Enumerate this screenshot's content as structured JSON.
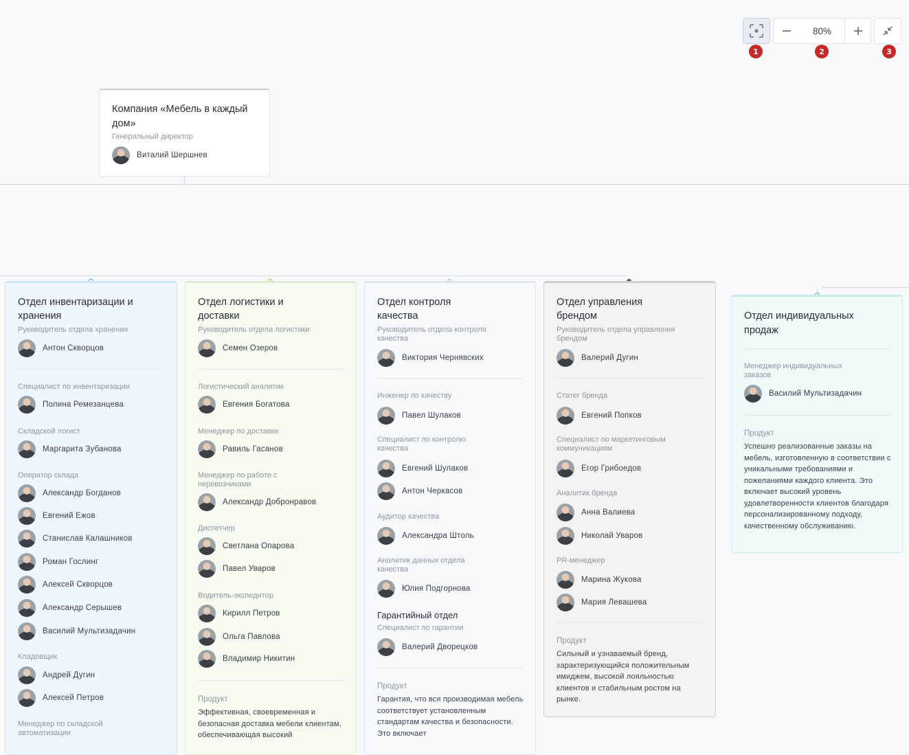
{
  "toolbar": {
    "zoom": "80%",
    "badges": [
      "1",
      "2",
      "3"
    ]
  },
  "colors": {
    "blue": "#3fa3d9",
    "green": "#8dc63f",
    "steel": "#9fb6cc",
    "dark": "#555a5f",
    "teal": "#2ab0a0"
  },
  "root": {
    "title": "Компания «Мебель в каждый дом»",
    "role": "Генеральный директор",
    "person": "Виталий Шершнев"
  },
  "depts": [
    {
      "title": "Отдел инвентаризации и хранения",
      "head_role": "Руководитель отдела хранения",
      "head": "Антон Скворцов",
      "groups": [
        {
          "role": "Специалист по инвентаризации",
          "people": [
            "Полина Ремезанцева"
          ]
        },
        {
          "role": "Складской логист",
          "people": [
            "Маргарита Зубанова"
          ]
        },
        {
          "role": "Оператор склада",
          "people": [
            "Александр Богданов",
            "Евгений Ежов",
            "Станислав Калашников",
            "Роман Гослинг",
            "Алексей Скворцов",
            "Александр Серышев",
            "Василий Мультизадачин"
          ]
        },
        {
          "role": "Кладовщик",
          "people": [
            "Андрей Дугин",
            "Алексей Петров"
          ]
        },
        {
          "role": "Менеджер по складской автоматизации",
          "people": []
        }
      ]
    },
    {
      "title": "Отдел логистики и доставки",
      "head_role": "Руководитель отдела логистики",
      "head": "Семен Озеров",
      "groups": [
        {
          "role": "Логистический аналитик",
          "people": [
            "Евгения Богатова"
          ]
        },
        {
          "role": "Менеджер по доставке",
          "people": [
            "Равиль Гасанов"
          ]
        },
        {
          "role": "Менеджер по работе с перевозчиками",
          "people": [
            "Александр Добронравов"
          ]
        },
        {
          "role": "Диспетчер",
          "people": [
            "Светлана Опарова",
            "Павел Уваров"
          ]
        },
        {
          "role": "Водитель-экспедитор",
          "people": [
            "Кирилл Петров",
            "Ольга Павлова",
            "Владимир Никитин"
          ]
        }
      ],
      "product_label": "Продукт",
      "product": "Эффективная, своевременная и безопасная доставка мебели клиентам, обеспечивающая высокий"
    },
    {
      "title": "Отдел контроля качества",
      "head_role": "Руководитель отдела контроля качества",
      "head": "Виктория Чернявских",
      "groups": [
        {
          "role": "Инженер по качеству",
          "people": [
            "Павел Шулаков"
          ]
        },
        {
          "role": "Специалист по контролю качества",
          "people": [
            "Евгений Шулаков",
            "Антон Черкасов"
          ]
        },
        {
          "role": "Аудитор качества",
          "people": [
            "Александра Штоль"
          ]
        },
        {
          "role": "Аналитик данных отдела качества",
          "people": [
            "Юлия Подгорнова"
          ]
        }
      ],
      "sub_title": "Гарантийный отдел",
      "sub_role": "Специалист по гарантии",
      "sub_person": "Валерий Дворецков",
      "product_label": "Продукт",
      "product": "Гарантия, что вся производимая мебель соответствует установленным стандартам качества и безопасности. Это включает"
    },
    {
      "title": "Отдел управления брендом",
      "head_role": "Руководитель отдела управления брендом",
      "head": "Валерий Дугин",
      "groups": [
        {
          "role": "Статег бренда",
          "people": [
            "Евгений Попков"
          ]
        },
        {
          "role": "Специалист по маркетинговым коммуникациям",
          "people": [
            "Егор Грибоедов"
          ]
        },
        {
          "role": "Аналитик бренда",
          "people": [
            "Анна Валиева",
            "Николай Уваров"
          ]
        },
        {
          "role": "PR-менеджер",
          "people": [
            "Марина Жукова",
            "Мария Левашева"
          ]
        }
      ],
      "product_label": "Продукт",
      "product": "Сильный и узнаваемый бренд, характеризующийся положительным имиджем, высокой лояльностью клиентов и стабильным ростом на рынке."
    },
    {
      "title": "Отдел индивидуальных продаж",
      "head_role": "Менеджер индивидуальных заказов",
      "head": "Василий Мультизадачин",
      "product_label": "Продукт",
      "product": "Успешно реализованные заказы на мебель, изготовленную в соответствии с уникальными требованиями и пожеланиями каждого клиента. Это включает высокий уровень удовлетворенности клиентов благодаря персонализированному подходу, качественному обслуживанию."
    }
  ]
}
